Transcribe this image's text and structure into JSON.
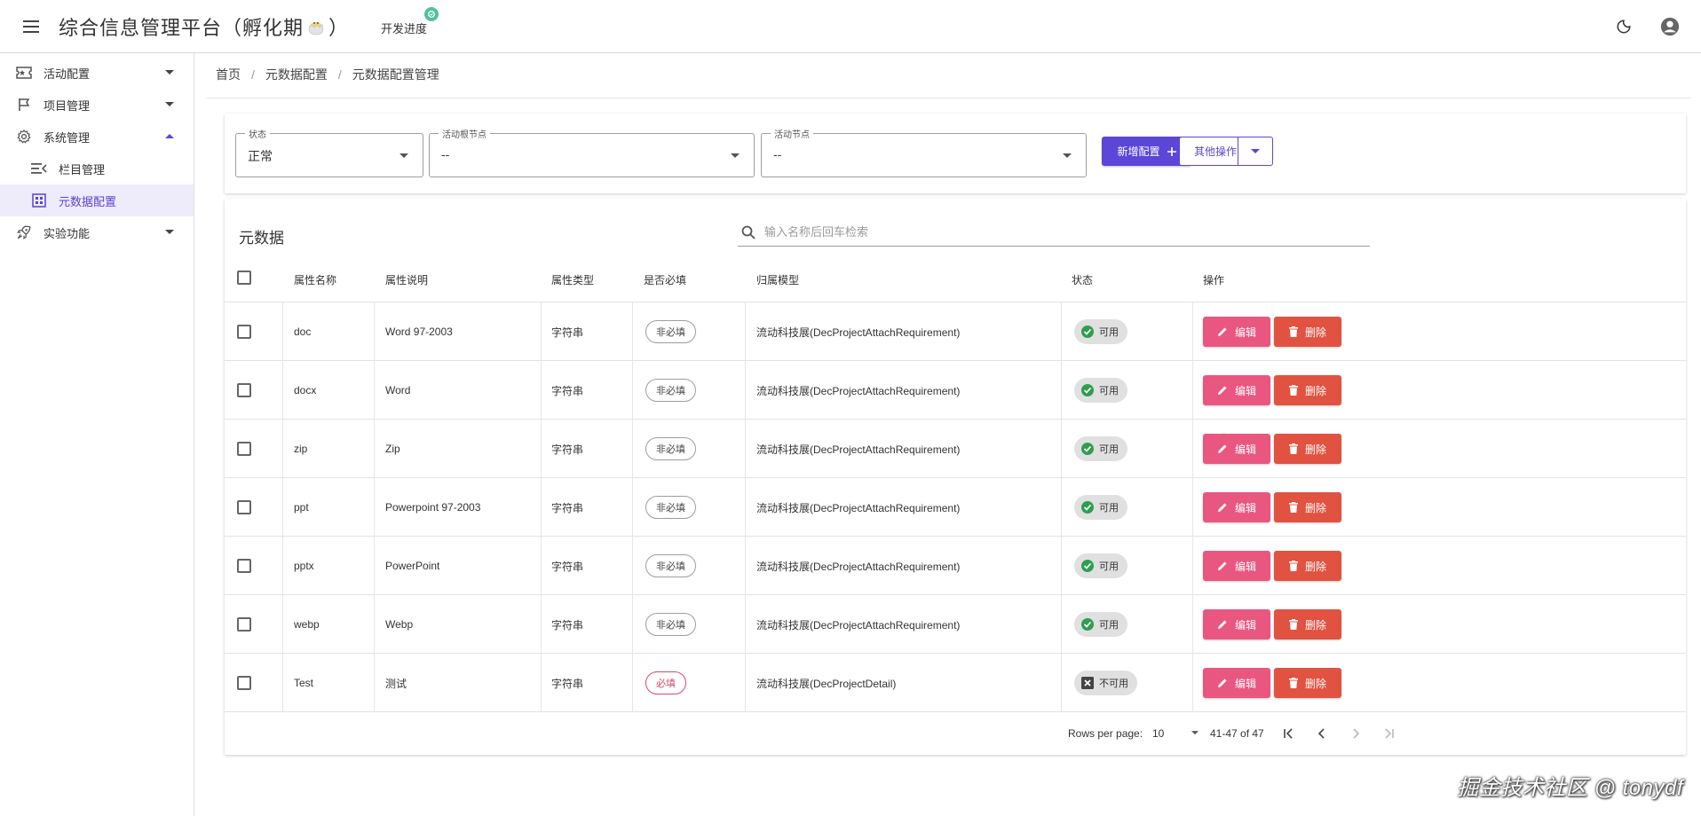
{
  "app": {
    "title_prefix": "综合信息管理平台（孵化期",
    "title_suffix": "）",
    "dev_progress": "开发进度"
  },
  "sidebar": {
    "items": [
      {
        "label": "活动配置",
        "icon": "ticket-icon"
      },
      {
        "label": "项目管理",
        "icon": "flag-icon"
      },
      {
        "label": "系统管理",
        "icon": "gear-icon"
      },
      {
        "label": "栏目管理",
        "icon": "menu-list-icon"
      },
      {
        "label": "元数据配置",
        "icon": "grid-icon"
      },
      {
        "label": "实验功能",
        "icon": "rocket-icon"
      }
    ]
  },
  "breadcrumb": [
    "首页",
    "元数据配置",
    "元数据配置管理"
  ],
  "filters": {
    "status": {
      "label": "状态",
      "value": "正常"
    },
    "root_node": {
      "label": "活动根节点",
      "value": "--"
    },
    "node": {
      "label": "活动节点",
      "value": "--"
    },
    "add_button": "新增配置",
    "other_button": "其他操作"
  },
  "table": {
    "title": "元数据",
    "search_placeholder": "输入名称后回车检索",
    "columns": [
      "属性名称",
      "属性说明",
      "属性类型",
      "是否必填",
      "归属模型",
      "状态",
      "操作"
    ],
    "edit_label": "编辑",
    "delete_label": "删除",
    "rows": [
      {
        "name": "doc",
        "desc": "Word 97-2003",
        "type": "字符串",
        "required": "非必填",
        "model": "流动科技展(DecProjectAttachRequirement)",
        "status": "可用"
      },
      {
        "name": "docx",
        "desc": "Word",
        "type": "字符串",
        "required": "非必填",
        "model": "流动科技展(DecProjectAttachRequirement)",
        "status": "可用"
      },
      {
        "name": "zip",
        "desc": "Zip",
        "type": "字符串",
        "required": "非必填",
        "model": "流动科技展(DecProjectAttachRequirement)",
        "status": "可用"
      },
      {
        "name": "ppt",
        "desc": "Powerpoint 97-2003",
        "type": "字符串",
        "required": "非必填",
        "model": "流动科技展(DecProjectAttachRequirement)",
        "status": "可用"
      },
      {
        "name": "pptx",
        "desc": "PowerPoint",
        "type": "字符串",
        "required": "非必填",
        "model": "流动科技展(DecProjectAttachRequirement)",
        "status": "可用"
      },
      {
        "name": "webp",
        "desc": "Webp",
        "type": "字符串",
        "required": "非必填",
        "model": "流动科技展(DecProjectAttachRequirement)",
        "status": "可用"
      },
      {
        "name": "Test",
        "desc": "测试",
        "type": "字符串",
        "required": "必填",
        "model": "流动科技展(DecProjectDetail)",
        "status": "不可用"
      }
    ]
  },
  "pagination": {
    "rows_per_page_label": "Rows per page:",
    "rows_per_page": "10",
    "range": "41-47 of 47"
  },
  "watermark": "掘金技术社区 @ tonydf",
  "colors": {
    "primary": "#5c46d8",
    "edit": "#e95781",
    "delete": "#e15241",
    "available": "#2e9e4f"
  }
}
